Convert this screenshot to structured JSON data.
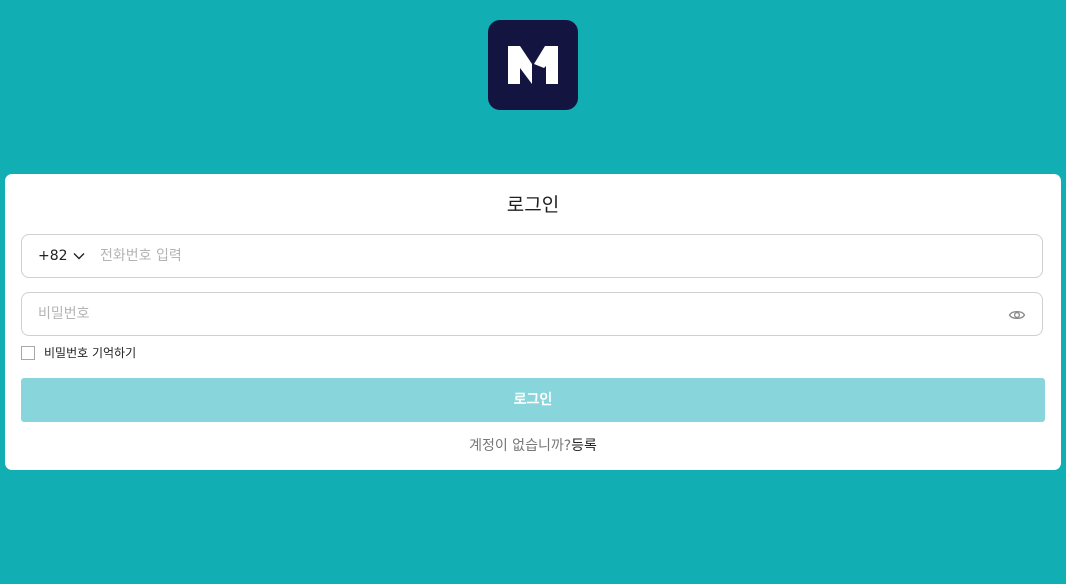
{
  "logo": {
    "icon": "m-logo-icon",
    "color": "#141440"
  },
  "form": {
    "title": "로그인",
    "country_code": "+82",
    "phone_placeholder": "전화번호 입력",
    "phone_value": "",
    "password_placeholder": "비밀번호",
    "password_value": "",
    "remember_label": "비밀번호 기억하기",
    "remember_checked": false,
    "login_button": "로그인",
    "signup_prompt": "계정이 없습니까?",
    "signup_link": "등록"
  },
  "colors": {
    "background": "#11afb4",
    "button": "#88d6db",
    "logo_bg": "#141440"
  }
}
